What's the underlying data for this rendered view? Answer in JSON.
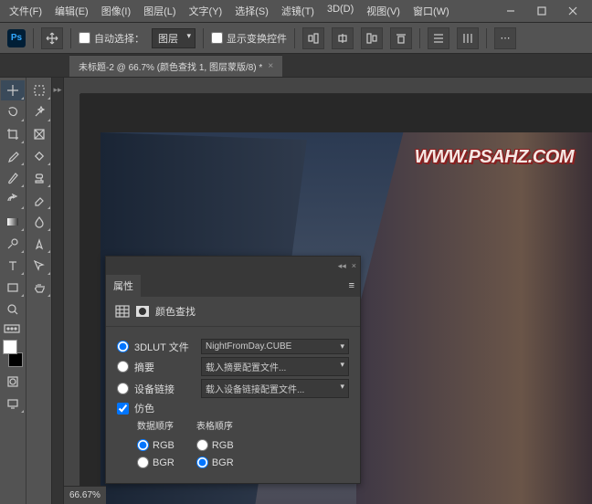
{
  "menu": [
    "文件(F)",
    "编辑(E)",
    "图像(I)",
    "图层(L)",
    "文字(Y)",
    "选择(S)",
    "滤镜(T)",
    "3D(D)",
    "视图(V)",
    "窗口(W)"
  ],
  "options": {
    "auto_select": "自动选择：",
    "layer": "图层",
    "show_transform": "显示变换控件"
  },
  "document_tab": "未标题-2 @ 66.7% (颜色查找 1, 图层蒙版/8) *",
  "watermark": "WWW.PSAHZ.COM",
  "panel": {
    "title": "属性",
    "subtitle": "颜色查找",
    "rows": {
      "lut_file": "3DLUT 文件",
      "lut_value": "NightFromDay.CUBE",
      "abstract": "摘要",
      "abstract_value": "载入摘要配置文件...",
      "device": "设备链接",
      "device_value": "载入设备链接配置文件...",
      "dither": "仿色",
      "data_order": "数据顺序",
      "table_order": "表格顺序",
      "rgb": "RGB",
      "bgr": "BGR"
    }
  },
  "status_zoom": "66.67%"
}
